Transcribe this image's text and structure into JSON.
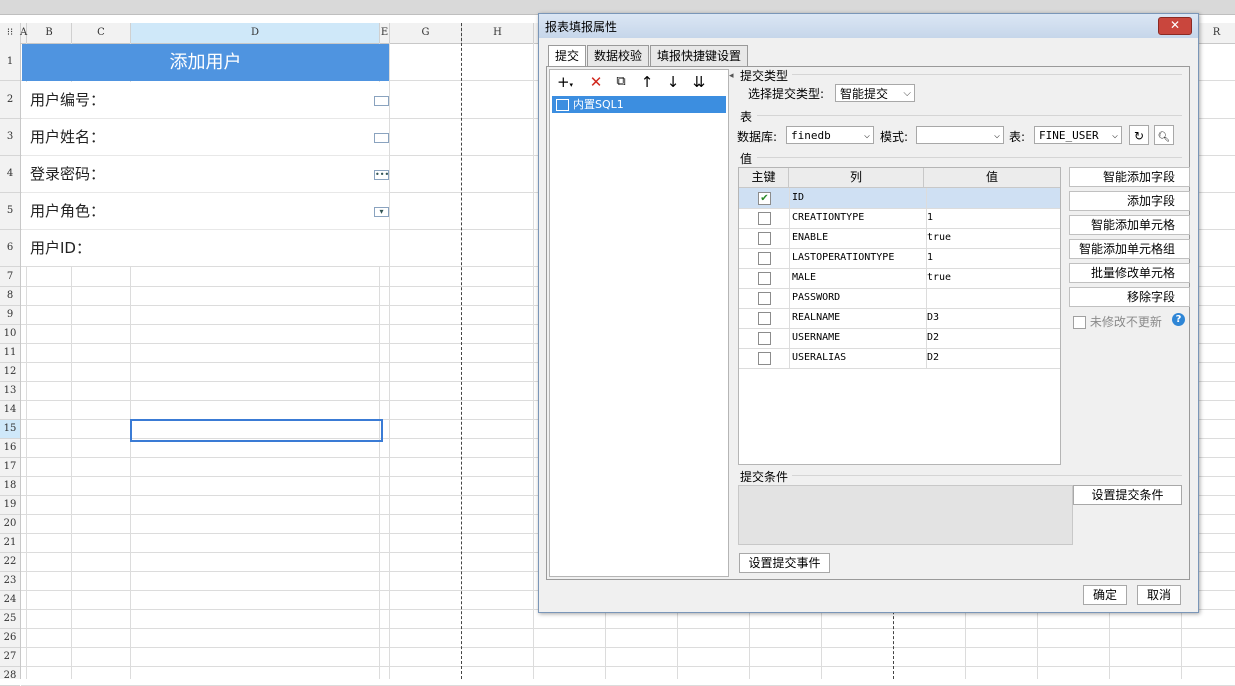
{
  "sheet": {
    "col_headers": [
      "A",
      "B",
      "C",
      "D",
      "E",
      "G",
      "H",
      "R"
    ],
    "row_headers": [
      "1",
      "2",
      "3",
      "4",
      "5",
      "6",
      "7",
      "8",
      "9",
      "10",
      "11",
      "12",
      "13",
      "14",
      "15",
      "16",
      "17",
      "18",
      "19",
      "20",
      "21",
      "22",
      "23",
      "24",
      "25",
      "26",
      "27",
      "28"
    ],
    "title": "添加用户",
    "form_labels": [
      "用户编号：",
      "用户姓名：",
      "登录密码：",
      "用户角色：",
      "用户ID："
    ]
  },
  "dialog": {
    "title": "报表填报属性",
    "close": "✕",
    "tabs": [
      "提交",
      "数据校验",
      "填报快捷键设置"
    ],
    "tree_item": "内置SQL1",
    "submit_type_section": "提交类型",
    "submit_type_label": "选择提交类型:",
    "submit_type_value": "智能提交",
    "table_section": "表",
    "db_label": "数据库:",
    "db_value": "finedb",
    "schema_label": "模式:",
    "schema_value": "",
    "table_label": "表:",
    "table_value": "FINE_USER",
    "value_section": "值",
    "columns": {
      "key": "主键",
      "col": "列",
      "val": "值"
    },
    "rows": [
      {
        "key": true,
        "col": "ID",
        "val": ""
      },
      {
        "key": false,
        "col": "CREATIONTYPE",
        "val": "1"
      },
      {
        "key": false,
        "col": "ENABLE",
        "val": "true"
      },
      {
        "key": false,
        "col": "LASTOPERATIONTYPE",
        "val": "1"
      },
      {
        "key": false,
        "col": "MALE",
        "val": "true"
      },
      {
        "key": false,
        "col": "PASSWORD",
        "val": ""
      },
      {
        "key": false,
        "col": "REALNAME",
        "val": "D3"
      },
      {
        "key": false,
        "col": "USERNAME",
        "val": "D2"
      },
      {
        "key": false,
        "col": "USERALIAS",
        "val": "D2"
      }
    ],
    "right_buttons": [
      "智能添加字段",
      "添加字段",
      "智能添加单元格",
      "智能添加单元格组",
      "批量修改单元格",
      "移除字段"
    ],
    "no_update_label": "未修改不更新",
    "condition_section": "提交条件",
    "set_condition": "设置提交条件",
    "set_event": "设置提交事件",
    "ok": "确定",
    "cancel": "取消"
  }
}
